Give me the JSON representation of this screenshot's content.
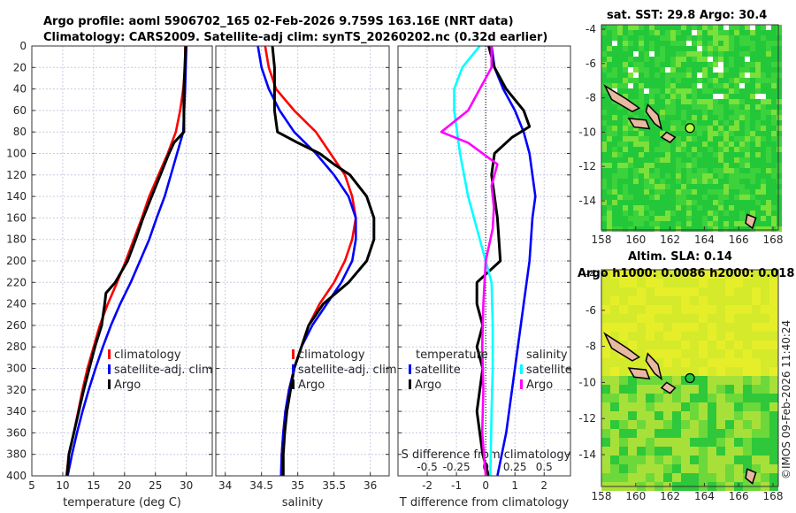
{
  "title_line1": "Argo profile: aoml 5906702_165 02-Feb-2026 9.759S 163.16E (NRT data)",
  "title_line2": "Climatology: CARS2009. Satellite-adj clim: synTS_20260202.nc (0.32d earlier)",
  "colors": {
    "climatology": "#ff0000",
    "satellite": "#0000ff",
    "argo": "#000000",
    "salinity_satellite": "#00ffff",
    "salinity_argo": "#ff00ff"
  },
  "chart_data": [
    {
      "type": "line",
      "name": "temperature",
      "xlabel": "temperature (deg C)",
      "ylabel": "",
      "xlim": [
        5,
        34.2
      ],
      "ylim": [
        400,
        0
      ],
      "xticks": [
        "5",
        "10",
        "15",
        "20",
        "25",
        "30"
      ],
      "yticks": [
        "0",
        "20",
        "40",
        "60",
        "80",
        "100",
        "120",
        "140",
        "160",
        "180",
        "200",
        "220",
        "240",
        "260",
        "280",
        "300",
        "320",
        "340",
        "360",
        "380",
        "400"
      ],
      "grid": true,
      "legend": [
        "climatology",
        "satellite-adj. clim",
        "Argo"
      ],
      "series": [
        {
          "name": "climatology",
          "color": "#ff0000",
          "depth": [
            0,
            20,
            40,
            60,
            80,
            100,
            120,
            140,
            160,
            180,
            200,
            220,
            240,
            260,
            280,
            300,
            320,
            340,
            360,
            380,
            400
          ],
          "values": [
            29.8,
            29.8,
            29.5,
            29.0,
            28.3,
            27.0,
            25.5,
            24.0,
            22.8,
            21.5,
            20.2,
            18.8,
            17.3,
            16.0,
            15.0,
            14.0,
            13.2,
            12.5,
            11.8,
            11.0,
            10.6
          ]
        },
        {
          "name": "satellite-adj. clim",
          "color": "#0000ff",
          "depth": [
            0,
            40,
            80,
            100,
            120,
            140,
            160,
            180,
            200,
            220,
            240,
            260,
            280,
            300,
            320,
            340,
            360,
            380,
            400
          ],
          "values": [
            30.0,
            29.8,
            29.5,
            28.5,
            27.5,
            26.5,
            25.2,
            24.0,
            22.5,
            21.0,
            19.3,
            17.8,
            16.5,
            15.3,
            14.2,
            13.2,
            12.3,
            11.5,
            10.8
          ]
        },
        {
          "name": "Argo",
          "color": "#000000",
          "depth": [
            0,
            40,
            80,
            90,
            100,
            120,
            140,
            160,
            180,
            200,
            220,
            230,
            240,
            260,
            280,
            300,
            320,
            340,
            360,
            380,
            400
          ],
          "values": [
            29.9,
            29.6,
            29.6,
            28.0,
            27.2,
            25.8,
            24.4,
            23.0,
            21.8,
            20.5,
            18.5,
            17.0,
            16.8,
            16.3,
            15.2,
            14.3,
            13.4,
            12.6,
            11.8,
            11.0,
            10.7
          ]
        }
      ]
    },
    {
      "type": "line",
      "name": "salinity",
      "xlabel": "salinity",
      "xlim": [
        33.87,
        36.26
      ],
      "ylim": [
        400,
        0
      ],
      "xticks": [
        "34",
        "34.5",
        "35",
        "35.5",
        "36"
      ],
      "grid": true,
      "legend": [
        "climatology",
        "satellite-adj. clim",
        "Argo"
      ],
      "series": [
        {
          "name": "climatology",
          "color": "#ff0000",
          "depth": [
            0,
            20,
            40,
            60,
            80,
            100,
            120,
            140,
            160,
            180,
            200,
            220,
            240,
            260,
            280,
            300,
            320,
            340,
            360,
            380,
            400
          ],
          "values": [
            34.55,
            34.6,
            34.7,
            34.95,
            35.25,
            35.45,
            35.65,
            35.75,
            35.8,
            35.75,
            35.65,
            35.5,
            35.3,
            35.15,
            35.05,
            34.95,
            34.88,
            34.83,
            34.8,
            34.78,
            34.77
          ]
        },
        {
          "name": "satellite-adj. clim",
          "color": "#0000ff",
          "depth": [
            0,
            20,
            40,
            60,
            80,
            100,
            120,
            140,
            160,
            180,
            200,
            220,
            240,
            260,
            280,
            300,
            320,
            340,
            360,
            380,
            400
          ],
          "values": [
            34.45,
            34.5,
            34.6,
            34.75,
            34.95,
            35.25,
            35.5,
            35.7,
            35.8,
            35.8,
            35.75,
            35.6,
            35.4,
            35.2,
            35.05,
            34.95,
            34.88,
            34.83,
            34.8,
            34.78,
            34.77
          ]
        },
        {
          "name": "Argo",
          "color": "#000000",
          "depth": [
            0,
            20,
            40,
            60,
            80,
            90,
            100,
            110,
            120,
            140,
            160,
            180,
            200,
            220,
            240,
            260,
            280,
            300,
            320,
            340,
            360,
            380,
            400
          ],
          "values": [
            34.65,
            34.68,
            34.68,
            34.68,
            34.72,
            35.0,
            35.3,
            35.5,
            35.72,
            35.95,
            36.05,
            36.05,
            35.95,
            35.7,
            35.35,
            35.15,
            35.05,
            34.95,
            34.9,
            34.85,
            34.82,
            34.8,
            34.8
          ]
        }
      ]
    },
    {
      "type": "line",
      "name": "difference",
      "xlabel": "T difference from climatology",
      "xlabel_top": "S difference from climatology",
      "xlim": [
        -3.0,
        2.9
      ],
      "ylim": [
        400,
        0
      ],
      "xticks": [
        "-2",
        "-1",
        "0",
        "1",
        "2"
      ],
      "xticks_top": [
        "-0.5",
        "-0.25",
        "0",
        "0.25",
        "0.5"
      ],
      "grid": true,
      "legend_temperature_title": "temperature",
      "legend_salinity_title": "salinity",
      "legend_temperature": [
        "satellite",
        "Argo"
      ],
      "legend_salinity": [
        "satellite",
        "Argo"
      ],
      "series": [
        {
          "name": "T satellite",
          "color": "#0000ff",
          "units": "T",
          "depth": [
            0,
            20,
            40,
            60,
            80,
            100,
            120,
            140,
            160,
            200,
            240,
            280,
            320,
            360,
            400
          ],
          "values": [
            0.2,
            0.3,
            0.6,
            1.0,
            1.3,
            1.5,
            1.6,
            1.7,
            1.6,
            1.5,
            1.3,
            1.1,
            0.9,
            0.7,
            0.4
          ]
        },
        {
          "name": "T Argo",
          "color": "#000000",
          "units": "T",
          "depth": [
            0,
            20,
            40,
            60,
            75,
            85,
            100,
            120,
            160,
            200,
            220,
            240,
            260,
            280,
            300,
            340,
            380,
            400
          ],
          "values": [
            0.1,
            0.3,
            0.7,
            1.3,
            1.5,
            0.9,
            0.3,
            0.2,
            0.4,
            0.5,
            -0.3,
            -0.3,
            -0.1,
            -0.3,
            -0.1,
            -0.3,
            -0.1,
            0.1
          ]
        },
        {
          "name": "S satellite",
          "color": "#00ffff",
          "units": "S",
          "depth": [
            0,
            20,
            40,
            60,
            100,
            140,
            180,
            220,
            260,
            300,
            340,
            400
          ],
          "values": [
            -0.05,
            -0.2,
            -0.27,
            -0.27,
            -0.22,
            -0.15,
            -0.05,
            0.05,
            0.06,
            0.06,
            0.05,
            0.04
          ]
        },
        {
          "name": "S Argo",
          "color": "#ff00ff",
          "units": "S",
          "depth": [
            0,
            20,
            40,
            60,
            80,
            90,
            110,
            130,
            150,
            170,
            200,
            240,
            280,
            320,
            360,
            400
          ],
          "values": [
            0.05,
            0.05,
            -0.05,
            -0.15,
            -0.38,
            -0.15,
            0.1,
            0.05,
            0.07,
            0.06,
            0.0,
            -0.02,
            -0.03,
            -0.02,
            -0.03,
            0.0
          ]
        }
      ]
    }
  ],
  "map_sst": {
    "title": "sat. SST: 29.8 Argo: 30.4",
    "xticks": [
      "158",
      "160",
      "162",
      "164",
      "166",
      "168"
    ],
    "yticks": [
      "-4",
      "-6",
      "-8",
      "-10",
      "-12",
      "-14"
    ],
    "argo_lon": 163.16,
    "argo_lat": -9.759
  },
  "map_sla": {
    "title1": "Altim. SLA: 0.14",
    "title2": "Argo h1000: 0.0086 h2000: 0.018",
    "xticks": [
      "158",
      "160",
      "162",
      "164",
      "166",
      "168"
    ],
    "yticks": [
      "-4",
      "-6",
      "-8",
      "-10",
      "-12",
      "-14"
    ],
    "argo_lon": 163.16,
    "argo_lat": -9.759
  },
  "credit": "©IMOS 09-Feb-2026 11:40:24"
}
